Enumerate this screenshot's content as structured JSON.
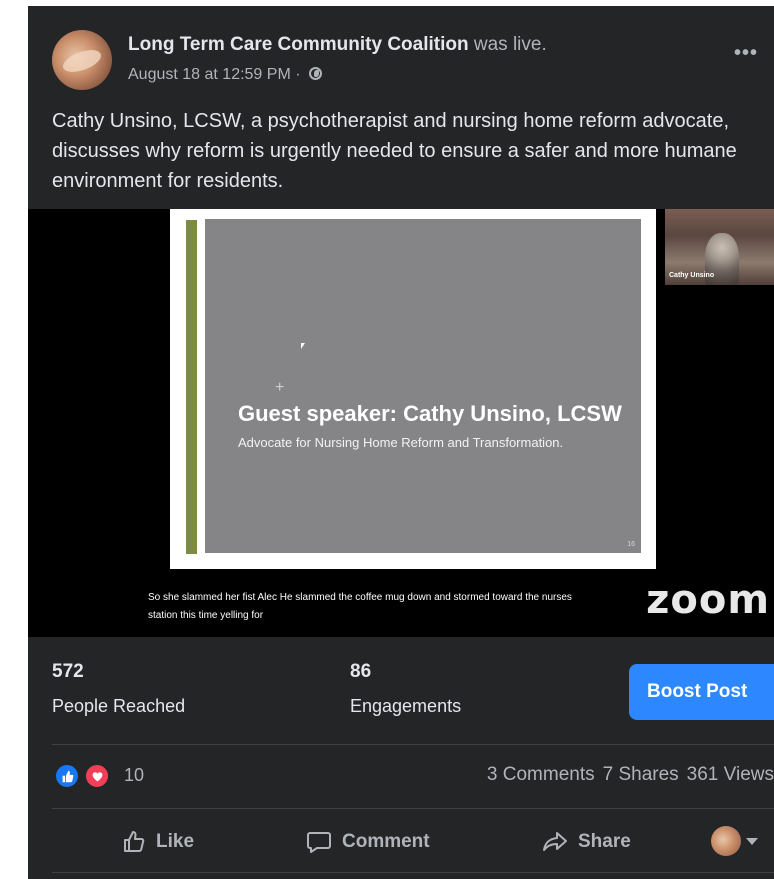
{
  "post": {
    "page_name": "Long Term Care Community Coalition",
    "live_suffix": "was live.",
    "timestamp": "August 18 at 12:59 PM ·",
    "audience_icon": "globe-icon",
    "menu_icon": "more-options-icon",
    "menu_label": "•••",
    "text": "Cathy Unsino, LCSW, a psychotherapist and nursing home reform advocate, discusses why reform is urgently needed to ensure a safer and more humane environment for residents."
  },
  "video": {
    "slide_title": "Guest speaker: Cathy Unsino, LCSW",
    "slide_subtitle": "Advocate for Nursing Home Reform and Transformation.",
    "slide_plus": "+",
    "slide_number": "16",
    "participant_name": "Cathy Unsino",
    "caption_line1": "So she slammed her fist Alec He slammed the coffee mug down and stormed toward the nurses",
    "caption_line2": "station this time yelling for",
    "watermark": "zoom"
  },
  "insights": {
    "reached_value": "572",
    "reached_label": "People Reached",
    "engagements_value": "86",
    "engagements_label": "Engagements",
    "boost_label": "Boost Post"
  },
  "reactions": {
    "icons": [
      "like-icon",
      "love-icon"
    ],
    "count": "10",
    "comments": "3 Comments",
    "shares": "7 Shares",
    "views": "361 Views"
  },
  "actions": {
    "like": "Like",
    "comment": "Comment",
    "share": "Share"
  },
  "colors": {
    "background": "#242526",
    "text": "#e4e6eb",
    "secondary_text": "#b0b3b8",
    "boost_blue": "#2d88ff",
    "like_blue": "#1877f2",
    "love_red": "#f33e58",
    "slide_accent": "#7d8c44"
  }
}
